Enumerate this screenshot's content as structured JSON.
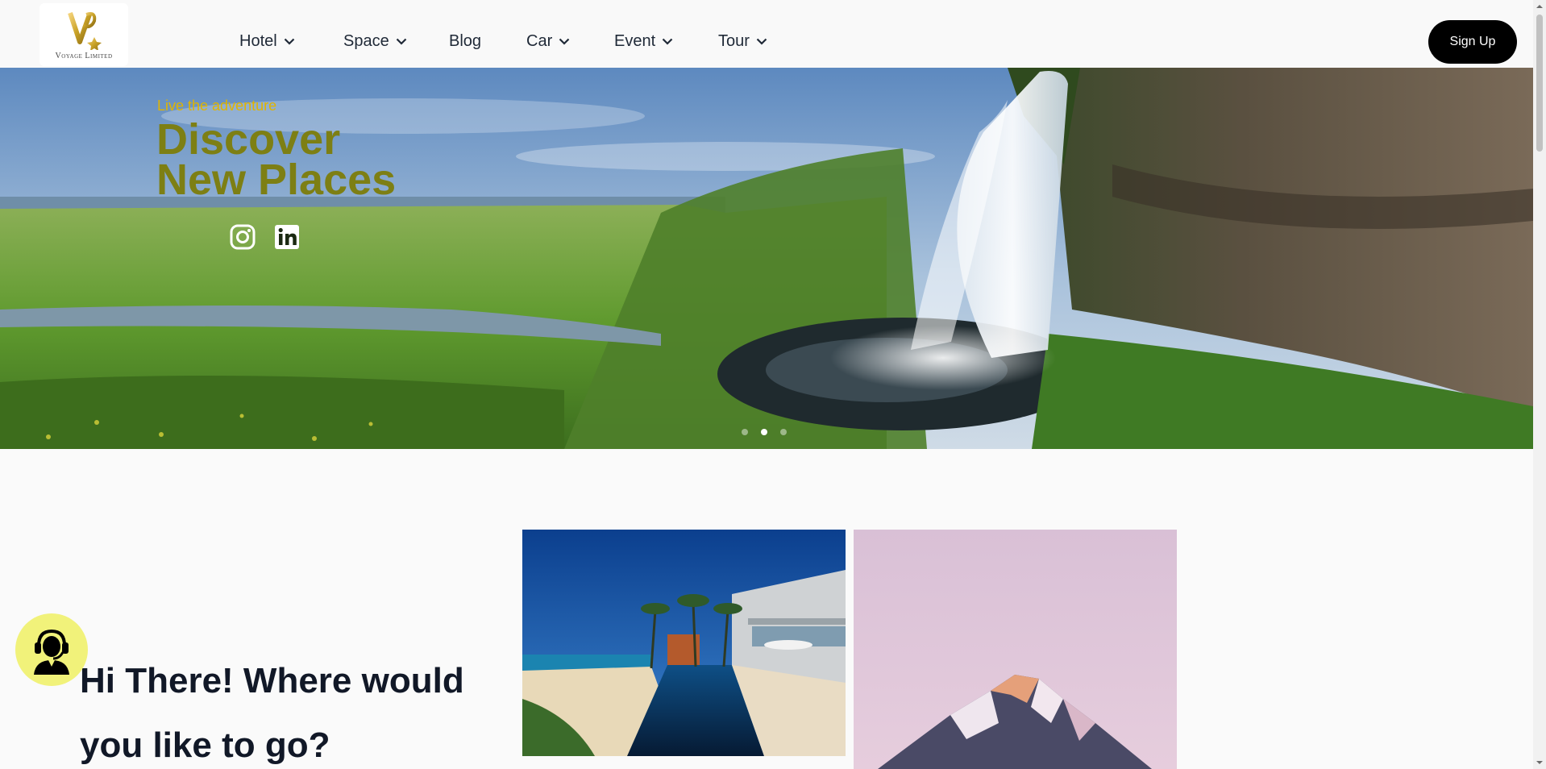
{
  "brand": {
    "name": "Voyage Limited",
    "logo_text": "Voyage Limited",
    "logo_color": "#c9a227"
  },
  "nav": {
    "items": [
      {
        "label": "Hotel",
        "has_dropdown": true
      },
      {
        "label": "Space",
        "has_dropdown": true
      },
      {
        "label": "Blog",
        "has_dropdown": false
      },
      {
        "label": "Car",
        "has_dropdown": true
      },
      {
        "label": "Event",
        "has_dropdown": true
      },
      {
        "label": "Tour",
        "has_dropdown": true
      }
    ]
  },
  "header": {
    "signup_label": "Sign Up"
  },
  "hero": {
    "tagline": "Live the adventure",
    "headline_line1": "Discover",
    "headline_line2": "New Places",
    "social": [
      {
        "icon": "instagram-icon"
      },
      {
        "icon": "linkedin-icon"
      }
    ],
    "slides": {
      "count": 3,
      "active": 2
    },
    "colors": {
      "tagline": "#e0b400",
      "headline": "#7d7f14"
    }
  },
  "main": {
    "greeting_line1": "Hi There! Where would",
    "greeting_line2": "you like to go?",
    "cards": [
      {
        "image": "luxury-pool-villa-image"
      },
      {
        "image": "snowy-mountain-peak-image"
      }
    ]
  },
  "support": {
    "icon": "customer-support-icon",
    "color": "#f1f27a"
  }
}
